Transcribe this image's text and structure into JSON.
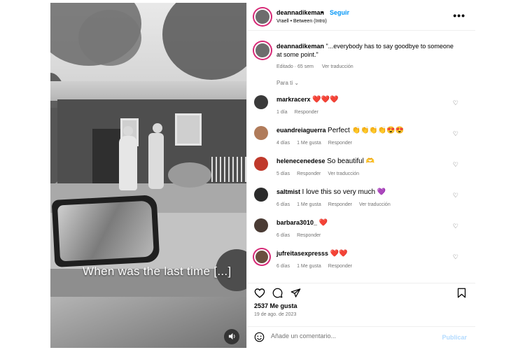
{
  "media": {
    "caption": "When was the last time [...]",
    "sound_icon": "speaker-icon"
  },
  "header": {
    "username": "deannadikeman",
    "separator": "•",
    "follow_label": "Seguir",
    "audio": "Vraell • Between (Intro)",
    "more_icon": "•••"
  },
  "post": {
    "username": "deannadikeman",
    "text": "\"...everybody has to say goodbye to someone at some point.\"",
    "edited": "Editado · 65 sem",
    "translate": "Ver traducción"
  },
  "filter": {
    "label": "Para ti",
    "chevron": "⌄"
  },
  "comments": [
    {
      "user": "markracerx",
      "text": "❤️❤️❤️",
      "time": "1 día",
      "likes": "",
      "reply": "Responder",
      "translate": ""
    },
    {
      "user": "euandreiaguerra",
      "text": "Perfect 👏👏👏👏😍😍",
      "time": "4 días",
      "likes": "1 Me gusta",
      "reply": "Responder",
      "translate": ""
    },
    {
      "user": "helenecenedese",
      "text": "So beautiful 🫶",
      "time": "5 días",
      "likes": "",
      "reply": "Responder",
      "translate": "Ver traducción"
    },
    {
      "user": "saltmist",
      "text": "I love this so very much 💜",
      "time": "6 días",
      "likes": "1 Me gusta",
      "reply": "Responder",
      "translate": "Ver traducción"
    },
    {
      "user": "barbara3010_",
      "text": "❤️",
      "time": "6 días",
      "likes": "",
      "reply": "Responder",
      "translate": ""
    },
    {
      "user": "jufreitasexpresss",
      "text": "❤️❤️",
      "time": "6 días",
      "likes": "1 Me gusta",
      "reply": "Responder",
      "translate": ""
    }
  ],
  "actions": {
    "like_icon": "♡",
    "comment_icon": "◯",
    "share_icon": "➤",
    "save_icon": "⧉"
  },
  "likes_count": "2537 Me gusta",
  "date": "19 de ago. de 2023",
  "add_comment": {
    "emoji_icon": "☺",
    "placeholder": "Añade un comentario...",
    "publish": "Publicar"
  },
  "colors": {
    "accent": "#0095f6",
    "story_ring": "#d62976",
    "muted": "#737373"
  }
}
